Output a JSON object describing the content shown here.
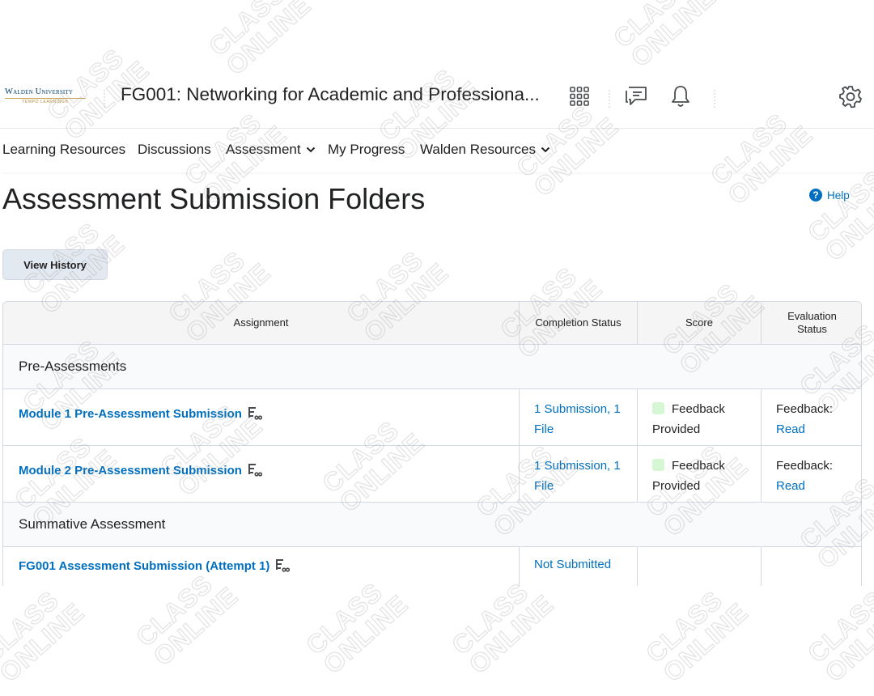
{
  "header": {
    "logo_name": "Walden University",
    "logo_sub": "TEMPO LEARNING®",
    "course_title": "FG001: Networking for Academic and Professiona...",
    "icons": [
      "grid-icon",
      "chat-icon",
      "bell-icon",
      "gear-icon"
    ]
  },
  "nav": {
    "items": [
      {
        "label": "Learning Resources"
      },
      {
        "label": "Discussions"
      },
      {
        "label": "Assessment",
        "has_menu": true
      },
      {
        "label": "My Progress"
      },
      {
        "label": "Walden Resources",
        "has_menu": true
      }
    ]
  },
  "page": {
    "title": "Assessment Submission Folders",
    "help_label": "Help",
    "view_history_label": "View History"
  },
  "table": {
    "headers": {
      "assignment": "Assignment",
      "completion": "Completion Status",
      "score": "Score",
      "evaluation": "Evaluation Status"
    },
    "groups": [
      {
        "label": "Pre-Assessments",
        "rows": [
          {
            "assignment": "Module 1 Pre-Assessment Submission",
            "completion": "1 Submission, 1 File",
            "score": "Feedback Provided",
            "eval_label": "Feedback:",
            "eval_link": "Read"
          },
          {
            "assignment": "Module 2 Pre-Assessment Submission",
            "completion": "1 Submission, 1 File",
            "score": "Feedback Provided",
            "eval_label": "Feedback:",
            "eval_link": "Read"
          }
        ]
      },
      {
        "label": "Summative Assessment",
        "rows": [
          {
            "assignment": "FG001 Assessment Submission (Attempt 1)",
            "completion": "Not Submitted",
            "score": "",
            "eval_label": "",
            "eval_link": ""
          }
        ]
      }
    ]
  },
  "watermark": {
    "line1": "CLASS",
    "line2": "ONLINE"
  },
  "colors": {
    "link": "#006fbf",
    "feedback_swatch": "#d6f7d4",
    "header_bg": "#f5f5f5",
    "border": "#d3d9e3"
  }
}
